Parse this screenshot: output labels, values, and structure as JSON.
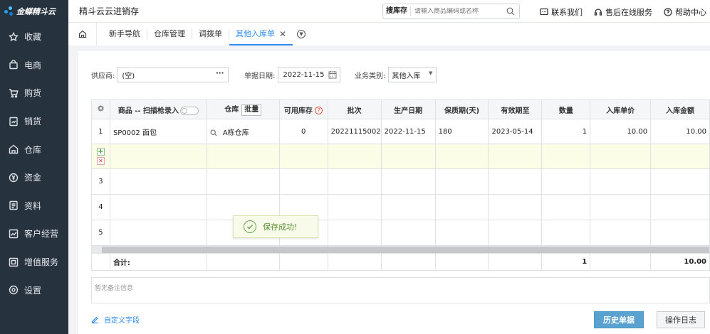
{
  "brand": {
    "logo_text": "金蝶精斗云"
  },
  "sidebar": {
    "items": [
      {
        "label": "收藏",
        "icon": "star-icon"
      },
      {
        "label": "电商",
        "icon": "shopping-bag-icon"
      },
      {
        "label": "购货",
        "icon": "cart-icon"
      },
      {
        "label": "销货",
        "icon": "sales-doc-icon"
      },
      {
        "label": "仓库",
        "icon": "warehouse-icon"
      },
      {
        "label": "资金",
        "icon": "yen-coin-icon"
      },
      {
        "label": "资料",
        "icon": "document-icon"
      },
      {
        "label": "客户经营",
        "icon": "chart-icon"
      },
      {
        "label": "增值服务",
        "icon": "gift-icon"
      },
      {
        "label": "设置",
        "icon": "gear-icon"
      }
    ]
  },
  "header": {
    "app_title": "精斗云云进销存",
    "search_scope": "搜库存",
    "search_placeholder": "请输入商品编码或名称",
    "contact": "联系我们",
    "service": "售后在线服务",
    "help": "帮助中心"
  },
  "tabs": [
    {
      "label": "新手导航"
    },
    {
      "label": "仓库管理"
    },
    {
      "label": "调拨单"
    },
    {
      "label": "其他入库单",
      "active": true
    }
  ],
  "form": {
    "supplier_label": "供应商:",
    "supplier_value": "(空)",
    "supplier_more": "···",
    "date_label": "单据日期:",
    "date_value": "2022-11-15",
    "type_label": "业务类别:",
    "type_value": "其他入库"
  },
  "grid": {
    "headers": {
      "product": "商品 -- 扫描枪录入",
      "warehouse": "仓库",
      "batch_btn": "批量",
      "stock": "可用库存",
      "lot": "批次",
      "mfg_date": "生产日期",
      "shelf_life": "保质期(天)",
      "expiry": "有效期至",
      "qty": "数量",
      "unit_price": "入库单价",
      "amount": "入库金额"
    },
    "rows": [
      {
        "no": "1",
        "product": "SP0002 面包",
        "warehouse": "A栋仓库",
        "stock": "0",
        "lot": "20221115002",
        "mfg_date": "2022-11-15",
        "shelf_life": "180",
        "expiry": "2023-05-14",
        "qty": "1",
        "unit_price": "10.00",
        "amount": "10.00"
      },
      {
        "no": "",
        "product": "",
        "warehouse": "",
        "stock": "",
        "lot": "",
        "mfg_date": "",
        "shelf_life": "",
        "expiry": "",
        "qty": "",
        "unit_price": "",
        "amount": ""
      },
      {
        "no": "3"
      },
      {
        "no": "4"
      },
      {
        "no": "5"
      }
    ],
    "total_label": "合计:",
    "total_qty": "1",
    "total_amount": "10.00"
  },
  "toast": {
    "message": "保存成功!"
  },
  "remark_placeholder": "暂无备注信息",
  "footer": {
    "custom_fields": "自定义字段",
    "history_button": "历史单据",
    "log_button": "操作日志"
  },
  "colors": {
    "sidebar_bg": "#27323f",
    "accent": "#2d8cf0",
    "primary_button": "#59a2d0",
    "selected_row": "#fcfde7"
  }
}
